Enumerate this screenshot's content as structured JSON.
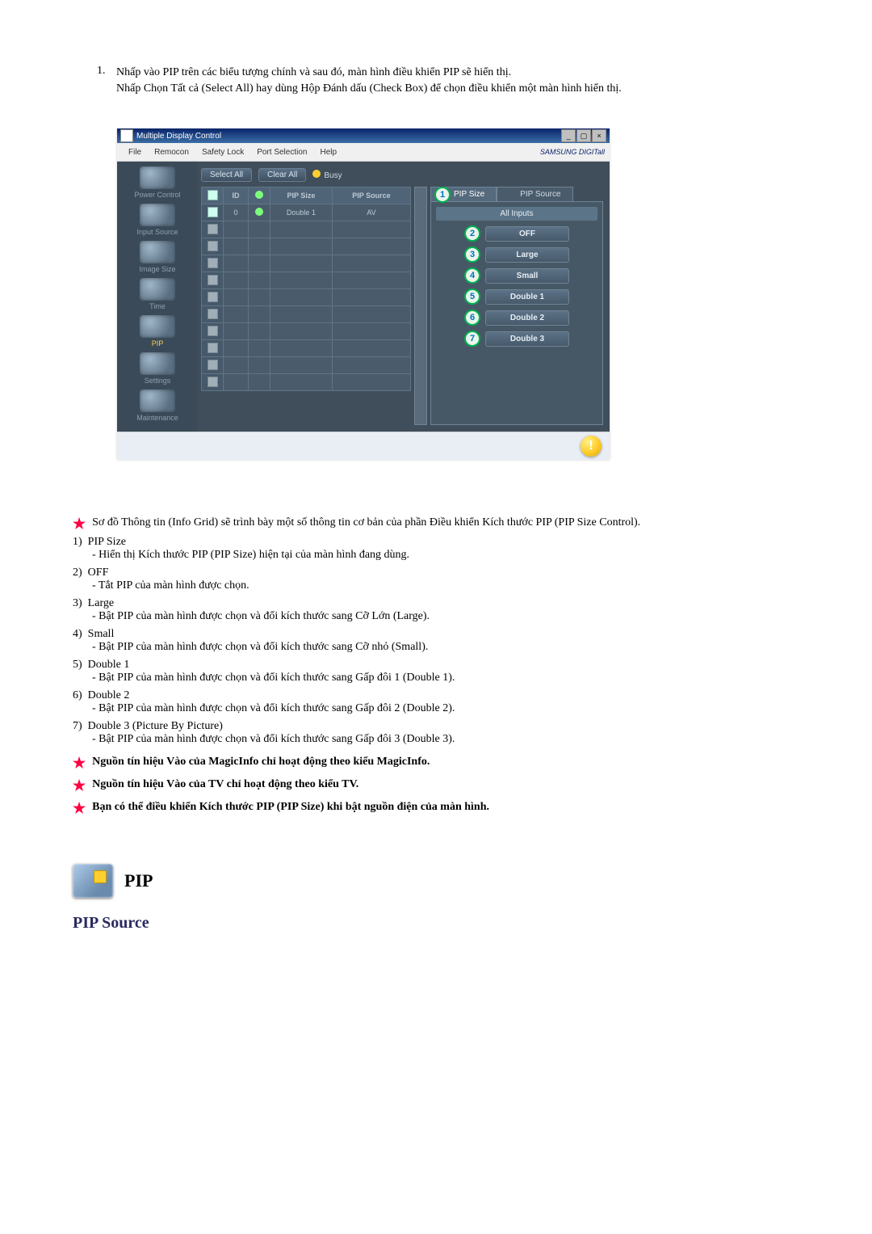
{
  "intro": {
    "num": "1.",
    "line1": "Nhấp vào PIP trên các biểu tượng chính và sau đó, màn hình điều khiển PIP sẽ hiển thị.",
    "line2": "Nhấp Chọn Tất cả (Select All) hay dùng Hộp Đánh dấu (Check Box) để chọn điều khiển một màn hình hiển thị."
  },
  "app": {
    "title": "Multiple Display Control",
    "menu": [
      "File",
      "Remocon",
      "Safety Lock",
      "Port Selection",
      "Help"
    ],
    "brand": "SAMSUNG DIGITall",
    "sidebar": [
      {
        "label": "Power Control"
      },
      {
        "label": ""
      },
      {
        "label": "Input Source"
      },
      {
        "label": "Image Size"
      },
      {
        "label": "Time"
      },
      {
        "label": "PIP",
        "active": true
      },
      {
        "label": "Settings"
      },
      {
        "label": "Maintenance"
      }
    ],
    "toolbar": {
      "select_all": "Select All",
      "clear_all": "Clear All",
      "busy": "Busy"
    },
    "grid": {
      "headers": [
        "",
        "ID",
        "",
        "PIP Size",
        "PIP Source"
      ],
      "row0": {
        "id": "0",
        "size": "Double 1",
        "source": "AV"
      }
    },
    "tabs": {
      "size": "PIP Size",
      "source": "PIP Source"
    },
    "panel": {
      "header": "All Inputs",
      "options": [
        {
          "n": "2",
          "label": "OFF"
        },
        {
          "n": "3",
          "label": "Large"
        },
        {
          "n": "4",
          "label": "Small"
        },
        {
          "n": "5",
          "label": "Double 1"
        },
        {
          "n": "6",
          "label": "Double 2"
        },
        {
          "n": "7",
          "label": "Double 3"
        }
      ],
      "callout1": "1"
    },
    "orb": "!"
  },
  "legend": {
    "intro": "Sơ đồ Thông tin (Info Grid) sẽ trình bày một số thông tin cơ bản của phần Điều khiển Kích thước PIP (PIP Size Control).",
    "items": [
      {
        "num": "1)",
        "title": "PIP Size",
        "desc": "- Hiển thị Kích thước PIP (PIP Size) hiện tại của màn hình đang dùng."
      },
      {
        "num": "2)",
        "title": "OFF",
        "desc": "- Tắt PIP của màn hình được chọn."
      },
      {
        "num": "3)",
        "title": "Large",
        "desc": "- Bật PIP của màn hình được chọn và đổi kích thước sang Cỡ Lớn (Large)."
      },
      {
        "num": "4)",
        "title": "Small",
        "desc": "- Bật PIP của màn hình được chọn và đổi kích thước sang Cỡ nhỏ (Small)."
      },
      {
        "num": "5)",
        "title": "Double 1",
        "desc": "- Bật PIP của màn hình được chọn và đổi kích thước sang Gấp đôi 1 (Double 1)."
      },
      {
        "num": "6)",
        "title": "Double 2",
        "desc": "- Bật PIP của màn hình được chọn và đổi kích thước sang Gấp đôi 2 (Double 2)."
      },
      {
        "num": "7)",
        "title": "Double 3 (Picture By Picture)",
        "desc": "- Bật PIP của màn hình được chọn và đổi kích thước sang Gấp đôi 3 (Double 3)."
      }
    ],
    "notes": [
      "Nguồn tín hiệu Vào của MagicInfo chỉ hoạt động theo kiểu MagicInfo.",
      "Nguồn tín hiệu Vào của TV chỉ hoạt động theo kiểu TV.",
      "Bạn có thể điều khiển Kích thước PIP (PIP Size) khi bật nguồn điện của màn hình."
    ]
  },
  "footer": {
    "pip_label": "PIP",
    "section": "PIP Source"
  }
}
